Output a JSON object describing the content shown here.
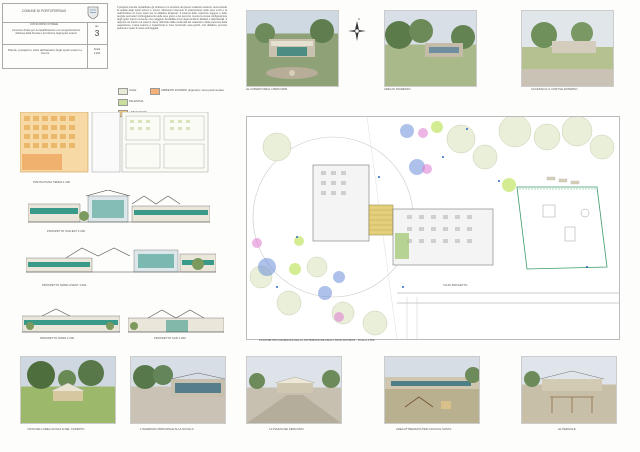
{
  "header": {
    "municipality": "COMUNE DI PORTOFERRAIO",
    "contest": "CONCORSO D'IDEE",
    "description": "Concorso d'idee per la riqualificazione e la riorganizzazione dell'area della Scuola e la fruizione degli spazi esterni",
    "sheet_label": "tav.",
    "sheet_number": "3",
    "scale_label": "Scala",
    "scale_value": "1:200",
    "subtitle": "Pianta, prospetti e vista dell'assetto degli spazi esterni e interni"
  },
  "project_text": "Il progetto intende riqualificare gli ambienti e le strutture dei plessi scolastici esistenti, aumentando la qualità degli spazi esterni e interni, attraverso interventi di sistemazione delle aree verdi e la realizzazione di nuovi spazi per la didattica all'aperto. Il sistema delle coperture leggere e delle pergole permette l'ombreggiamento delle aree gioco e dei percorsi, mentre la nuova configurazione degli spazi interni consente una maggiore flessibilità d'uso degli ambienti didattici e laboratoriali. Il rapporto tra interno ed esterno viene rafforzato dalla continuità dei materiali e dalla presenza della vegetazione. L'area esterna è organizzata in zone funzionali: area giochi, orto didattico, percorsi pedonali e spazi di sosta ombreggiati.",
  "legend": {
    "items": [
      "AULE",
      "PALESTRA",
      "LABORATORI"
    ],
    "note": "AMBIENTI ESTERNI (legenda) / area pavimentata"
  },
  "north_symbol": "N",
  "captions": {
    "view_top_1": "LE COPERTURE E I PERCORSI",
    "view_top_2": "AREA DI INGRESSO",
    "view_top_3": "ACCESSO E IL CORTILE ESTERNO",
    "plan": "PIANTA PIANO TERRA 1:200",
    "elev_1": "PROSPETTO SUD-EST 1:200",
    "elev_2": "PROSPETTO NORD-OVEST 1:200",
    "elev_3": "PROSPETTO NORD 1:200",
    "elev_4": "PROSPETTO SUD 1:200",
    "site_plan": "PLANIMETRIA GENERALE DELLA SISTEMAZIONE DEGLI SPAZI ESTERNI - SCALA 1:500",
    "site_road": "VIA DI PROGETTO",
    "view_bottom_1": "VISTA DELL'AREA GIOCHI E DEL COPERTO",
    "view_bottom_2": "L'INGRESSO PRINCIPALE ALLA SCUOLA",
    "view_bottom_3": "LA PIAZZA DEI PERCORSI",
    "view_bottom_4": "AREA ATTREZZATA PER GIOCHI E SOSTA",
    "view_bottom_5": "LE PERGOLE"
  },
  "colors": {
    "plan_orange": "#f1c57a",
    "plan_green": "#c9df9e",
    "facade_teal": "#3a9a8a",
    "sky": "#d5dde6",
    "grass": "#9cb86a",
    "pavement": "#c9c2b5"
  }
}
